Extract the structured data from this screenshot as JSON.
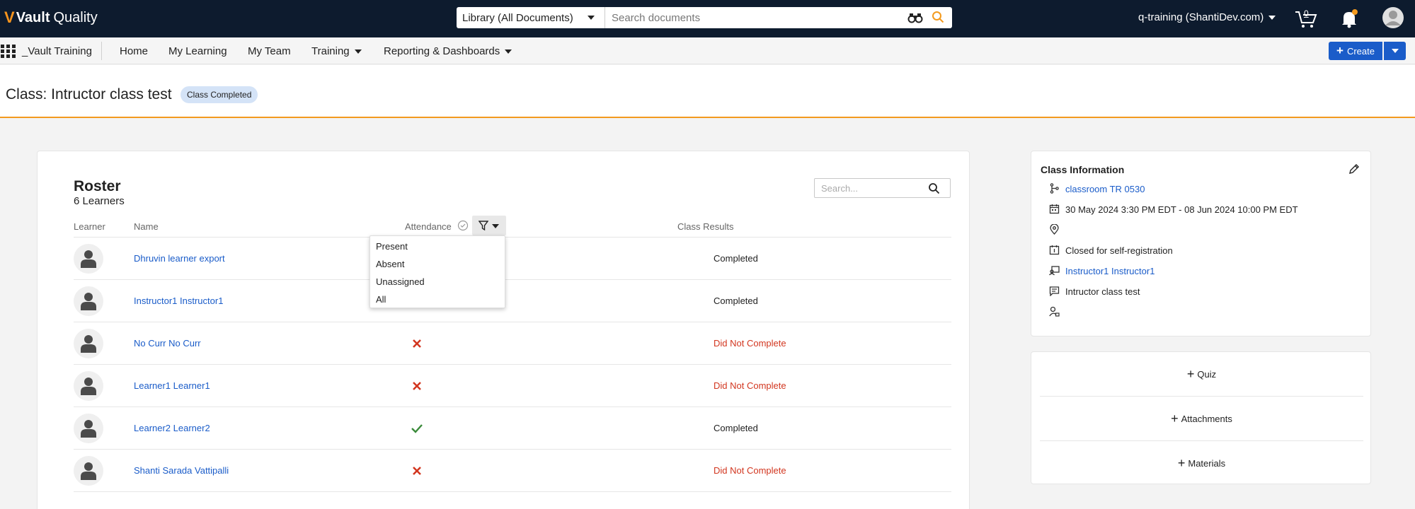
{
  "topbar": {
    "logo_mark": "V",
    "logo_brand": "Vault",
    "logo_product": "Quality",
    "library_select": "Library (All Documents)",
    "search_placeholder": "Search documents",
    "user_label": "q-training (ShantiDev.com)",
    "cart_count": "0"
  },
  "nav": {
    "app_name": "_Vault Training",
    "items": [
      "Home",
      "My Learning",
      "My Team",
      "Training",
      "Reporting & Dashboards"
    ],
    "create_label": "Create"
  },
  "page": {
    "title": "Class: Intructor class test",
    "status": "Class Completed"
  },
  "roster": {
    "title": "Roster",
    "count": "6 Learners",
    "search_placeholder": "Search...",
    "columns": {
      "learner": "Learner",
      "name": "Name",
      "attendance": "Attendance",
      "results": "Class Results"
    },
    "rows": [
      {
        "name": "Dhruvin learner export",
        "attendance": "present",
        "result": "Completed"
      },
      {
        "name": "Instructor1 Instructor1",
        "attendance": "present",
        "result": "Completed"
      },
      {
        "name": "No Curr No Curr",
        "attendance": "absent",
        "result": "Did Not Complete"
      },
      {
        "name": "Learner1 Learner1",
        "attendance": "absent",
        "result": "Did Not Complete"
      },
      {
        "name": "Learner2 Learner2",
        "attendance": "present",
        "result": "Completed"
      },
      {
        "name": "Shanti Sarada Vattipalli",
        "attendance": "absent",
        "result": "Did Not Complete"
      }
    ],
    "filter_options": [
      "Present",
      "Absent",
      "Unassigned",
      "All"
    ]
  },
  "class_info": {
    "title": "Class Information",
    "classroom": "classroom TR 0530",
    "dates": "30 May 2024 3:30 PM EDT - 08 Jun 2024 10:00 PM EDT",
    "location": "",
    "registration": "Closed for self-registration",
    "instructor": "Instructor1 Instructor1",
    "description": "Intructor class test",
    "owner": ""
  },
  "actions": {
    "quiz": "Quiz",
    "attachments": "Attachments",
    "materials": "Materials"
  },
  "colors": {
    "topbar": "#0d1b2e",
    "accent_orange": "#f39a1e",
    "link_blue": "#1a5cc9",
    "fail_red": "#d2361f",
    "success_green": "#3a8a3a"
  }
}
